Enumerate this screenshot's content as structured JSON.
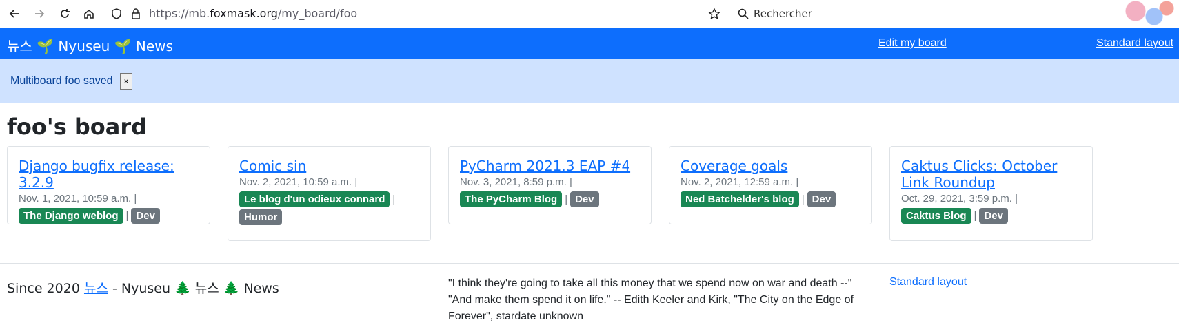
{
  "browser": {
    "url_prefix": "https://mb.",
    "url_host": "foxmask.org",
    "url_path": "/my_board/foo",
    "search_placeholder": "Rechercher"
  },
  "navbar": {
    "brand": "뉴스 🌱 Nyuseu 🌱 News",
    "edit_link": "Edit my board",
    "layout_link": "Standard layout"
  },
  "alert": {
    "message": "Multiboard foo saved",
    "close_label": "×"
  },
  "board": {
    "title": "foo's board",
    "cards": [
      {
        "title": "Django bugfix release: 3.2.9",
        "date": "Nov. 1, 2021, 10:59 a.m. |",
        "source": "The Django weblog",
        "tags": [
          "Dev"
        ]
      },
      {
        "title": "Comic sin",
        "date": "Nov. 2, 2021, 10:59 a.m. |",
        "source": "Le blog d'un odieux connard",
        "tags": [
          "Humor"
        ]
      },
      {
        "title": "PyCharm 2021.3 EAP #4",
        "date": "Nov. 3, 2021, 8:59 p.m. |",
        "source": "The PyCharm Blog",
        "tags": [
          "Dev"
        ]
      },
      {
        "title": "Coverage goals",
        "date": "Nov. 2, 2021, 12:59 a.m. |",
        "source": "Ned Batchelder's blog",
        "tags": [
          "Dev"
        ]
      },
      {
        "title": "Caktus Clicks: October Link Roundup",
        "date": "Oct. 29, 2021, 3:59 p.m. |",
        "source": "Caktus Blog",
        "tags": [
          "Dev"
        ]
      }
    ]
  },
  "footer": {
    "since": "Since 2020",
    "since_link": "뉴스",
    "since_rest": "- Nyuseu 🌲 뉴스 🌲 News",
    "quote_line1": "\"I think they're going to take all this money that we spend now on war and death --\"",
    "quote_line2": "\"And make them spend it on life.\" -- Edith Keeler and Kirk, \"The City on the Edge of Forever\", stardate unknown",
    "layout_link": "Standard layout"
  },
  "colors": {
    "primary": "#0d6efd",
    "alert_bg": "#cfe2ff",
    "badge_source": "#198754",
    "badge_tag": "#6c757d"
  },
  "icons": [
    "back-icon",
    "forward-icon",
    "reload-icon",
    "home-icon",
    "shield-icon",
    "lock-icon",
    "star-icon",
    "search-icon"
  ]
}
